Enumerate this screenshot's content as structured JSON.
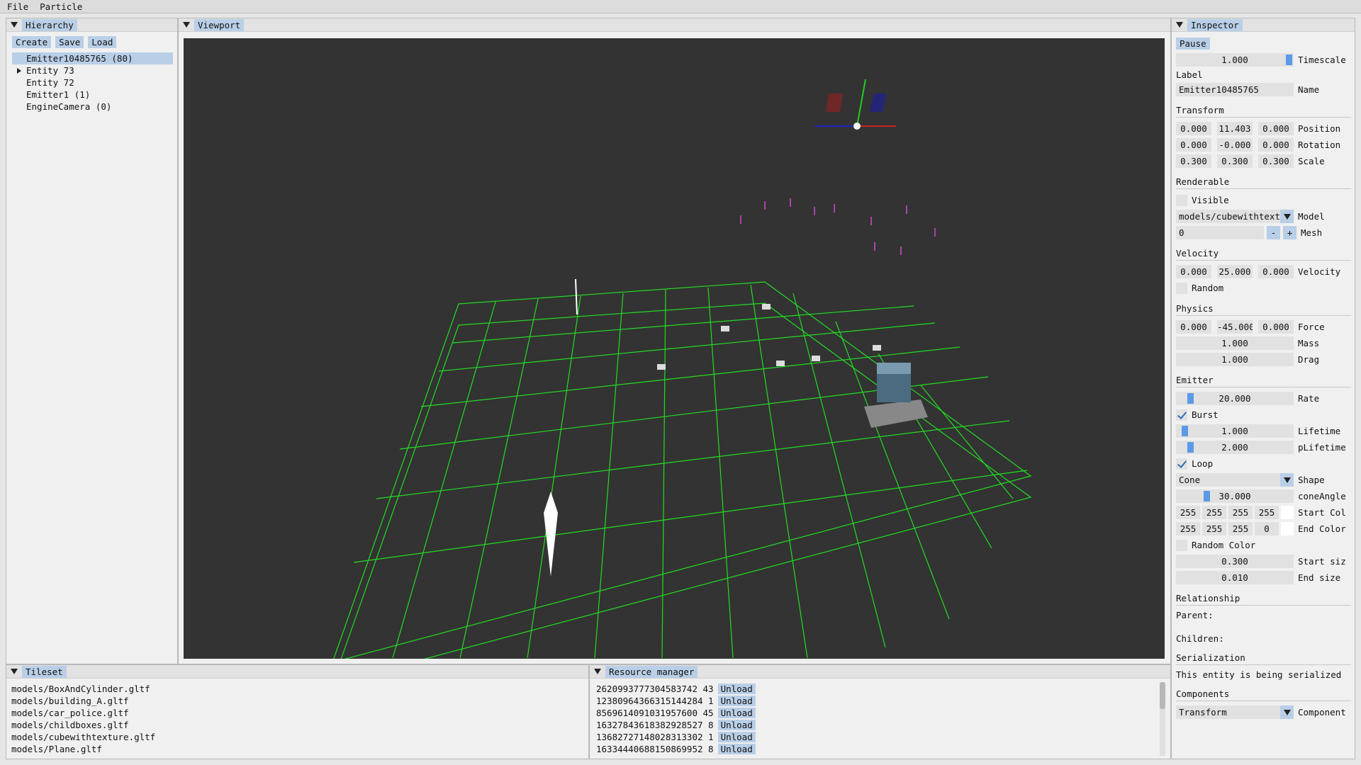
{
  "menu": [
    "File",
    "Particle"
  ],
  "hierarchy": {
    "title": "Hierarchy",
    "buttons": [
      "Create",
      "Save",
      "Load"
    ],
    "items": [
      "Emitter10485765 (80)",
      "Entity 73",
      "Entity 72",
      "Emitter1 (1)",
      "EngineCamera (0)"
    ]
  },
  "viewport": {
    "title": "Viewport"
  },
  "inspector": {
    "title": "Inspector",
    "pause": "Pause",
    "timescale": {
      "value": "1.000",
      "label": "Timescale"
    },
    "label_section": "Label",
    "name": {
      "value": "Emitter10485765",
      "label": "Name"
    },
    "transform": {
      "title": "Transform",
      "position": {
        "x": "0.000",
        "y": "11.403",
        "z": "0.000",
        "label": "Position"
      },
      "rotation": {
        "x": "0.000",
        "y": "-0.000",
        "z": "0.000",
        "label": "Rotation"
      },
      "scale": {
        "x": "0.300",
        "y": "0.300",
        "z": "0.300",
        "label": "Scale"
      }
    },
    "renderable": {
      "title": "Renderable",
      "visible": "Visible",
      "model": {
        "value": "models/cubewithtextur",
        "label": "Model"
      },
      "mesh": {
        "value": "0",
        "label": "Mesh",
        "minus": "-",
        "plus": "+"
      }
    },
    "velocity": {
      "title": "Velocity",
      "x": "0.000",
      "y": "25.000",
      "z": "0.000",
      "label": "Velocity",
      "random": "Random"
    },
    "physics": {
      "title": "Physics",
      "force": {
        "x": "0.000",
        "y": "-45.000",
        "z": "0.000",
        "label": "Force"
      },
      "mass": {
        "value": "1.000",
        "label": "Mass"
      },
      "drag": {
        "value": "1.000",
        "label": "Drag"
      }
    },
    "emitter": {
      "title": "Emitter",
      "rate": {
        "value": "20.000",
        "label": "Rate",
        "fraction": 0.1
      },
      "burst": "Burst",
      "lifetime": {
        "value": "1.000",
        "label": "Lifetime",
        "fraction": 0.05
      },
      "plifetime": {
        "value": "2.000",
        "label": "pLifetime",
        "fraction": 0.1
      },
      "loop": "Loop",
      "shape": {
        "value": "Cone",
        "label": "Shape"
      },
      "cone_angle": {
        "value": "30.000",
        "label": "coneAngle",
        "fraction": 0.25
      },
      "start_color": {
        "r": "255",
        "g": "255",
        "b": "255",
        "a": "255",
        "label": "Start Col"
      },
      "end_color": {
        "r": "255",
        "g": "255",
        "b": "255",
        "a": "0",
        "label": "End Color"
      },
      "random_color": "Random Color",
      "start_size": {
        "value": "0.300",
        "label": "Start siz"
      },
      "end_size": {
        "value": "0.010",
        "label": "End size"
      }
    },
    "relationship": {
      "title": "Relationship",
      "parent": "Parent:",
      "children": "Children:"
    },
    "serialization": {
      "title": "Serialization",
      "text": "This entity is being serialized"
    },
    "components": {
      "title": "Components",
      "value": "Transform",
      "label": "Component"
    }
  },
  "tileset": {
    "title": "Tileset",
    "items": [
      "models/BoxAndCylinder.gltf",
      "models/building_A.gltf",
      "models/car_police.gltf",
      "models/childboxes.gltf",
      "models/cubewithtexture.gltf",
      "models/Plane.gltf"
    ]
  },
  "resources": {
    "title": "Resource manager",
    "unload": "Unload",
    "items": [
      "2620993777304583742 43",
      "12380964366315144284 1",
      "8569614091031957600 45",
      "16327843618382928527 8",
      "13682727148028313302 1",
      "16334440688150869952 8"
    ]
  },
  "colors": {
    "accent": "#b9cfe7",
    "grid": "#00ff00",
    "viewport_bg": "#333333"
  }
}
